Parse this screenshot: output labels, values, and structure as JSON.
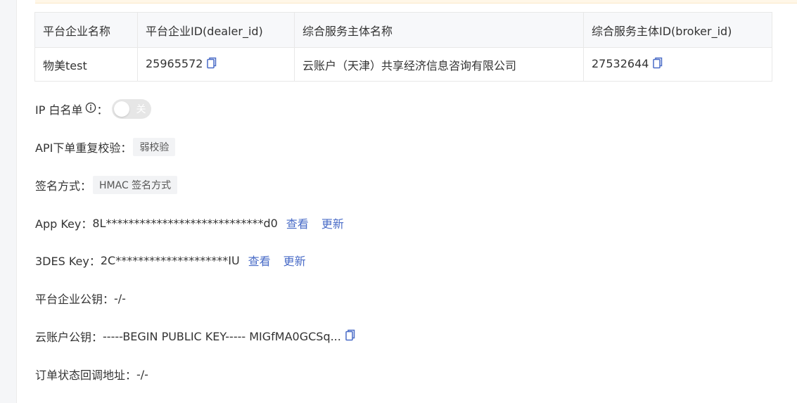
{
  "table": {
    "headers": [
      "平台企业名称",
      "平台企业ID(dealer_id)",
      "综合服务主体名称",
      "综合服务主体ID(broker_id)"
    ],
    "row": {
      "dealer_name": "物美test",
      "dealer_id": "25965572",
      "broker_name": "云账户（天津）共享经济信息咨询有限公司",
      "broker_id": "27532644"
    }
  },
  "ip_whitelist": {
    "label": "IP 白名单",
    "colon": "：",
    "toggle_text": "关",
    "enabled": false
  },
  "api_check": {
    "label": "API下单重复校验：",
    "tag": "弱校验"
  },
  "sign_method": {
    "label": "签名方式：",
    "tag": "HMAC 签名方式"
  },
  "app_key": {
    "label": "App Key：",
    "value": "8L****************************d0",
    "view": "查看",
    "update": "更新"
  },
  "des_key": {
    "label": "3DES Key：",
    "value": "2C********************IU",
    "view": "查看",
    "update": "更新"
  },
  "dealer_pubkey": {
    "label": "平台企业公钥：",
    "value": "-/-"
  },
  "yzh_pubkey": {
    "label": "云账户公钥：",
    "value": "-----BEGIN PUBLIC KEY----- MIGfMA0GCSq..."
  },
  "callback_url": {
    "label": "订单状态回调地址：",
    "value": "-/-"
  },
  "colors": {
    "link": "#4a6cc7",
    "toggle_off": "#e6e6e6",
    "header_bg": "#f7f8fa"
  }
}
